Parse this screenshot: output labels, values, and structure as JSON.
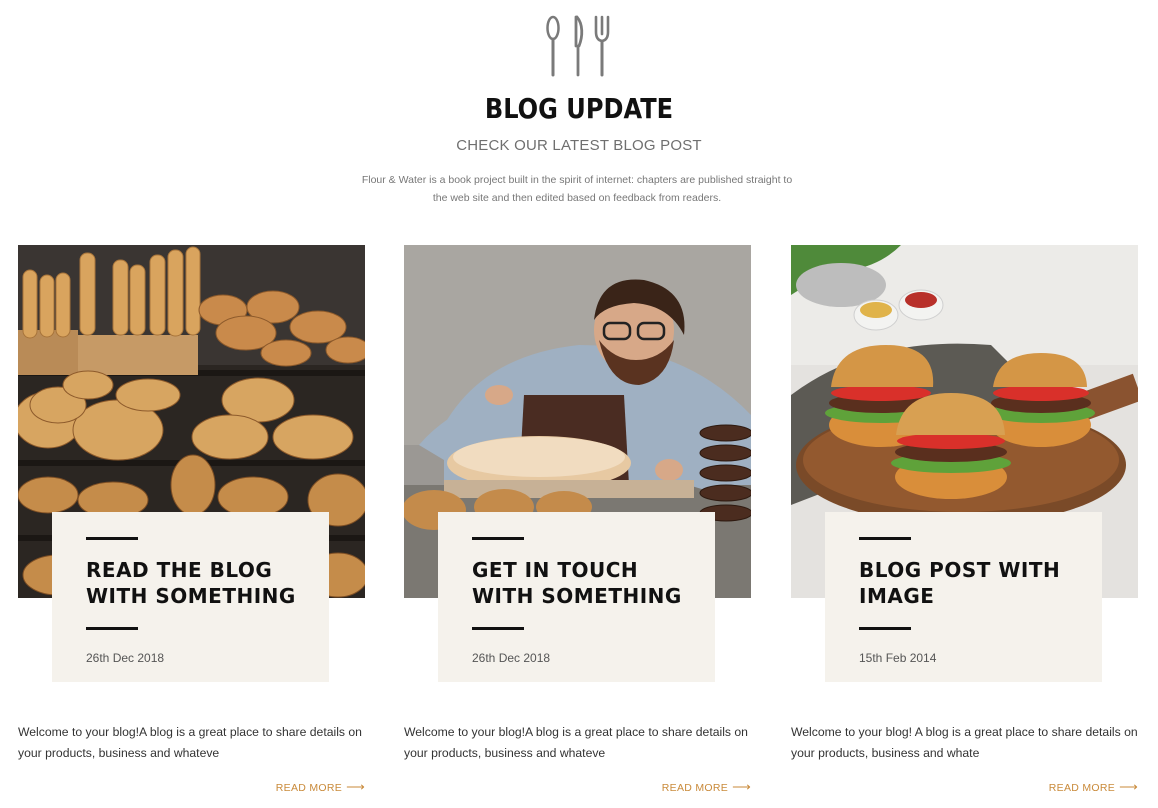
{
  "header": {
    "icon": "cutlery-icon",
    "title": "BLOG UPDATE",
    "subtitle": "CHECK OUR LATEST BLOG POST",
    "intro": "Flour & Water is a book project built in the spirit of internet: chapters are published straight to the web site and then edited based on feedback from readers."
  },
  "posts": [
    {
      "image": "bakery-bread-shelves-photo",
      "title": "READ THE BLOG WITH SOMETHING",
      "date": "26th Dec 2018",
      "excerpt": "Welcome to your blog!A blog is a great place to share details on your products, business and whateve",
      "read_more": "READ MORE"
    },
    {
      "image": "baker-shaping-loaf-photo",
      "title": "GET IN TOUCH WITH SOMETHING",
      "date": "26th Dec 2018",
      "excerpt": "Welcome to your blog!A blog is a great place to share details on your products, business and whateve",
      "read_more": "READ MORE"
    },
    {
      "image": "burgers-on-board-photo",
      "title": "BLOG POST WITH IMAGE",
      "date": "15th Feb 2014",
      "excerpt": "Welcome to your blog! A blog is a great place to share details on your products, business and whate",
      "read_more": "READ MORE"
    }
  ],
  "colors": {
    "accent": "#c98a3a",
    "box_background": "#f5f2ec",
    "title": "#111111"
  }
}
